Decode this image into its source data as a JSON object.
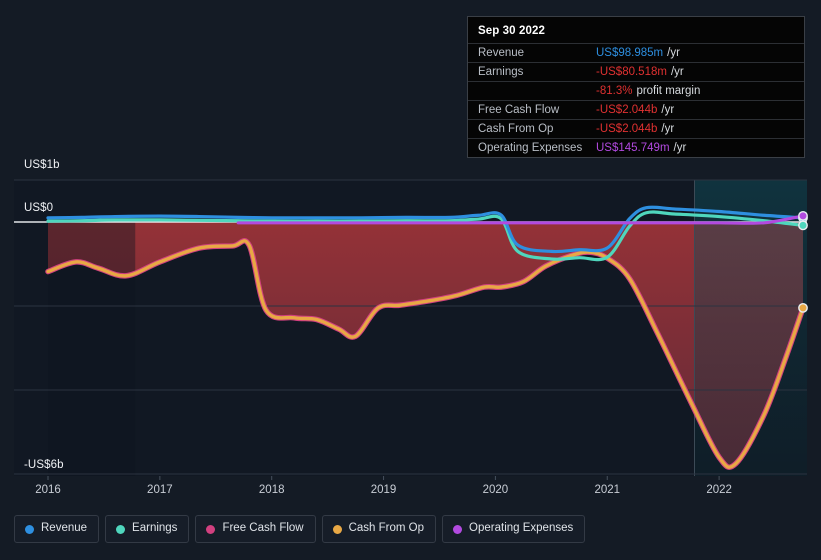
{
  "theme": {
    "background": "#141b25",
    "plot_background": "#111823",
    "gridline": "#2b3340",
    "forecast_tint": "#0d3c46",
    "negative_fill": "#8f2f33"
  },
  "tooltip": {
    "title": "Sep 30 2022",
    "rows": [
      {
        "label": "Revenue",
        "value": "US$98.985m",
        "suffix": "/yr",
        "color_class": "v-blue"
      },
      {
        "label": "Earnings",
        "value": "-US$80.518m",
        "suffix": "/yr",
        "color_class": "v-red"
      },
      {
        "label": "",
        "value": "-81.3%",
        "suffix": "profit margin",
        "color_class": "v-red"
      },
      {
        "label": "Free Cash Flow",
        "value": "-US$2.044b",
        "suffix": "/yr",
        "color_class": "v-red"
      },
      {
        "label": "Cash From Op",
        "value": "-US$2.044b",
        "suffix": "/yr",
        "color_class": "v-red"
      },
      {
        "label": "Operating Expenses",
        "value": "US$145.749m",
        "suffix": "/yr",
        "color_class": "v-purple"
      }
    ]
  },
  "legend": {
    "items": [
      {
        "label": "Revenue",
        "color": "#2e8fe0"
      },
      {
        "label": "Earnings",
        "color": "#4fd6bd"
      },
      {
        "label": "Free Cash Flow",
        "color": "#d1407f"
      },
      {
        "label": "Cash From Op",
        "color": "#e8a845"
      },
      {
        "label": "Operating Expenses",
        "color": "#b24ae0"
      }
    ]
  },
  "axes": {
    "y_top_label": "US$1b",
    "y_zero_label": "US$0",
    "y_bottom_label": "-US$6b",
    "x_ticks": [
      "2016",
      "2017",
      "2018",
      "2019",
      "2020",
      "2021",
      "2022"
    ]
  },
  "chart_data": {
    "type": "area",
    "title": "",
    "subtitle": "",
    "xlabel": "",
    "ylabel": "US$",
    "ylim": [
      -6,
      1
    ],
    "y_tick_values": [
      1,
      0,
      -2,
      -4,
      -6
    ],
    "y_tick_labels": [
      "US$1b",
      "US$0",
      "",
      "",
      "-US$6b"
    ],
    "x": [
      "2016",
      "2017",
      "2018",
      "2019",
      "2020",
      "2021",
      "2022"
    ],
    "xlim": [
      "2016",
      "2022.75"
    ],
    "grid": true,
    "legend_position": "bottom",
    "units": "billions of US$",
    "forecast_start": "2021.78",
    "series": [
      {
        "name": "Revenue",
        "color": "#2e8fe0",
        "points": [
          [
            2016.0,
            0.1
          ],
          [
            2016.3,
            0.11
          ],
          [
            2016.6,
            0.13
          ],
          [
            2017.0,
            0.14
          ],
          [
            2017.35,
            0.13
          ],
          [
            2017.7,
            0.11
          ],
          [
            2018.0,
            0.1
          ],
          [
            2018.4,
            0.1
          ],
          [
            2018.8,
            0.1
          ],
          [
            2019.2,
            0.11
          ],
          [
            2019.6,
            0.11
          ],
          [
            2019.85,
            0.16
          ],
          [
            2020.05,
            0.17
          ],
          [
            2020.2,
            -0.55
          ],
          [
            2020.5,
            -0.7
          ],
          [
            2020.75,
            -0.66
          ],
          [
            2021.0,
            -0.62
          ],
          [
            2021.2,
            0.08
          ],
          [
            2021.35,
            0.34
          ],
          [
            2021.6,
            0.31
          ],
          [
            2022.0,
            0.25
          ],
          [
            2022.4,
            0.16
          ],
          [
            2022.75,
            0.099
          ]
        ]
      },
      {
        "name": "Earnings",
        "color": "#4fd6bd",
        "points": [
          [
            2016.0,
            0.02
          ],
          [
            2016.3,
            0.03
          ],
          [
            2016.6,
            0.05
          ],
          [
            2017.0,
            0.05
          ],
          [
            2017.35,
            0.04
          ],
          [
            2017.7,
            0.03
          ],
          [
            2018.0,
            0.02
          ],
          [
            2018.4,
            0.02
          ],
          [
            2018.8,
            0.02
          ],
          [
            2019.2,
            0.03
          ],
          [
            2019.6,
            0.03
          ],
          [
            2019.85,
            0.07
          ],
          [
            2020.05,
            0.08
          ],
          [
            2020.2,
            -0.7
          ],
          [
            2020.5,
            -0.88
          ],
          [
            2020.75,
            -0.85
          ],
          [
            2021.0,
            -0.84
          ],
          [
            2021.2,
            -0.1
          ],
          [
            2021.35,
            0.22
          ],
          [
            2021.6,
            0.19
          ],
          [
            2022.0,
            0.13
          ],
          [
            2022.4,
            0.03
          ],
          [
            2022.75,
            -0.081
          ]
        ]
      },
      {
        "name": "Free Cash Flow",
        "color": "#d1407f",
        "points": [
          [
            2016.0,
            -1.18
          ],
          [
            2016.25,
            -0.95
          ],
          [
            2016.45,
            -1.1
          ],
          [
            2016.7,
            -1.28
          ],
          [
            2017.0,
            -0.95
          ],
          [
            2017.35,
            -0.62
          ],
          [
            2017.65,
            -0.57
          ],
          [
            2017.8,
            -0.56
          ],
          [
            2017.95,
            -2.1
          ],
          [
            2018.2,
            -2.28
          ],
          [
            2018.4,
            -2.32
          ],
          [
            2018.6,
            -2.55
          ],
          [
            2018.75,
            -2.72
          ],
          [
            2018.95,
            -2.05
          ],
          [
            2019.15,
            -1.98
          ],
          [
            2019.4,
            -1.88
          ],
          [
            2019.65,
            -1.75
          ],
          [
            2019.9,
            -1.55
          ],
          [
            2020.05,
            -1.55
          ],
          [
            2020.25,
            -1.42
          ],
          [
            2020.45,
            -1.05
          ],
          [
            2020.7,
            -0.78
          ],
          [
            2020.85,
            -0.72
          ],
          [
            2021.0,
            -0.86
          ],
          [
            2021.2,
            -1.35
          ],
          [
            2021.45,
            -2.65
          ],
          [
            2021.75,
            -4.3
          ],
          [
            2022.0,
            -5.6
          ],
          [
            2022.15,
            -5.75
          ],
          [
            2022.4,
            -4.6
          ],
          [
            2022.6,
            -3.2
          ],
          [
            2022.75,
            -2.044
          ]
        ]
      },
      {
        "name": "Cash From Op",
        "color": "#e8a845",
        "points": [
          [
            2016.0,
            -1.18
          ],
          [
            2016.25,
            -0.95
          ],
          [
            2016.45,
            -1.1
          ],
          [
            2016.7,
            -1.28
          ],
          [
            2017.0,
            -0.95
          ],
          [
            2017.35,
            -0.62
          ],
          [
            2017.65,
            -0.57
          ],
          [
            2017.8,
            -0.56
          ],
          [
            2017.95,
            -2.1
          ],
          [
            2018.2,
            -2.28
          ],
          [
            2018.4,
            -2.32
          ],
          [
            2018.6,
            -2.55
          ],
          [
            2018.75,
            -2.72
          ],
          [
            2018.95,
            -2.05
          ],
          [
            2019.15,
            -1.98
          ],
          [
            2019.4,
            -1.88
          ],
          [
            2019.65,
            -1.75
          ],
          [
            2019.9,
            -1.55
          ],
          [
            2020.05,
            -1.55
          ],
          [
            2020.25,
            -1.42
          ],
          [
            2020.45,
            -1.05
          ],
          [
            2020.7,
            -0.78
          ],
          [
            2020.85,
            -0.72
          ],
          [
            2021.0,
            -0.86
          ],
          [
            2021.2,
            -1.35
          ],
          [
            2021.45,
            -2.65
          ],
          [
            2021.75,
            -4.3
          ],
          [
            2022.0,
            -5.6
          ],
          [
            2022.15,
            -5.75
          ],
          [
            2022.4,
            -4.6
          ],
          [
            2022.6,
            -3.2
          ],
          [
            2022.75,
            -2.044
          ]
        ]
      },
      {
        "name": "Operating Expenses",
        "color": "#b24ae0",
        "points": [
          [
            2017.7,
            -0.02
          ],
          [
            2018.0,
            -0.02
          ],
          [
            2018.5,
            -0.02
          ],
          [
            2019.0,
            -0.02
          ],
          [
            2019.5,
            -0.02
          ],
          [
            2020.0,
            -0.02
          ],
          [
            2020.5,
            -0.02
          ],
          [
            2021.0,
            -0.02
          ],
          [
            2021.5,
            -0.02
          ],
          [
            2022.0,
            -0.02
          ],
          [
            2022.4,
            -0.02
          ],
          [
            2022.75,
            0.146
          ]
        ]
      }
    ]
  }
}
